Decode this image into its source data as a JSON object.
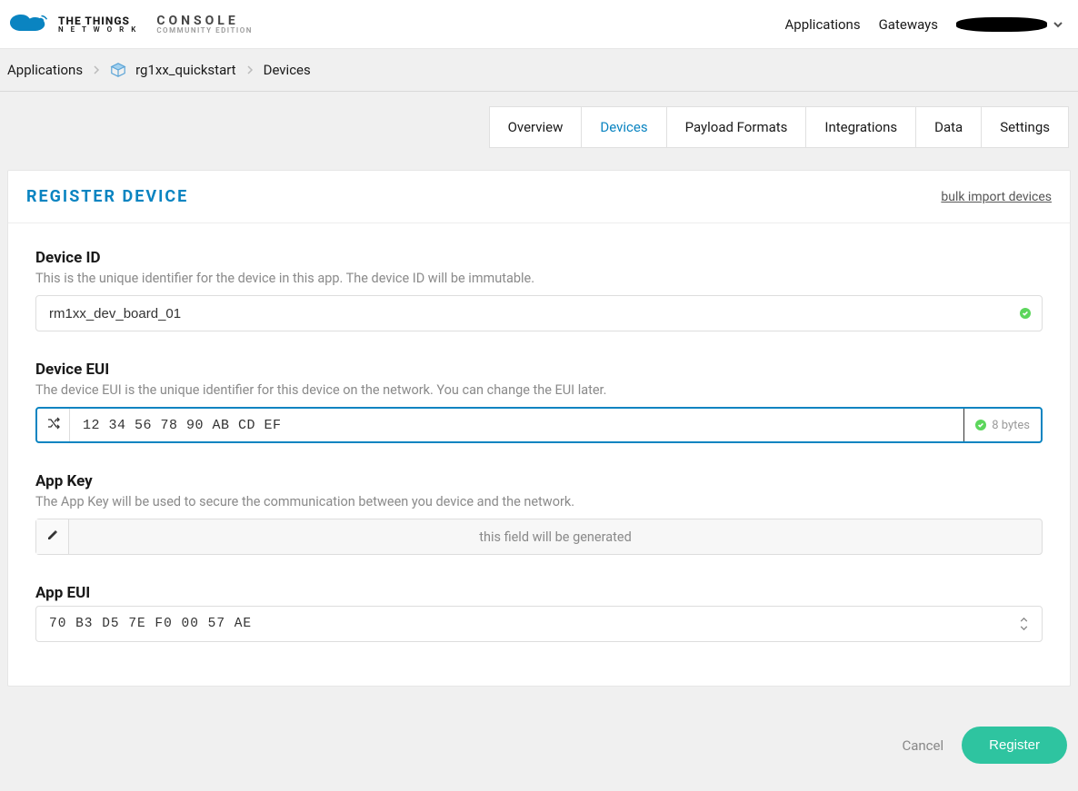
{
  "header": {
    "brand_line1": "THE THINGS",
    "brand_line2": "N E T W O R K",
    "console_line1": "CONSOLE",
    "console_line2": "COMMUNITY EDITION",
    "nav_applications": "Applications",
    "nav_gateways": "Gateways"
  },
  "breadcrumb": {
    "applications": "Applications",
    "app_name": "rg1xx_quickstart",
    "devices": "Devices"
  },
  "tabs": {
    "overview": "Overview",
    "devices": "Devices",
    "payload_formats": "Payload Formats",
    "integrations": "Integrations",
    "data": "Data",
    "settings": "Settings"
  },
  "panel": {
    "title": "REGISTER DEVICE",
    "bulk_link": "bulk import devices"
  },
  "device_id": {
    "label": "Device ID",
    "help": "This is the unique identifier for the device in this app. The device ID will be immutable.",
    "value": "rm1xx_dev_board_01"
  },
  "device_eui": {
    "label": "Device EUI",
    "help": "The device EUI is the unique identifier for this device on the network. You can change the EUI later.",
    "value": "12 34 56 78 90 AB CD EF",
    "bytes_label": "8 bytes"
  },
  "app_key": {
    "label": "App Key",
    "help": "The App Key will be used to secure the communication between you device and the network.",
    "placeholder": "this field will be generated"
  },
  "app_eui": {
    "label": "App EUI",
    "value": "70 B3 D5 7E F0 00 57 AE"
  },
  "footer": {
    "cancel": "Cancel",
    "register": "Register"
  }
}
